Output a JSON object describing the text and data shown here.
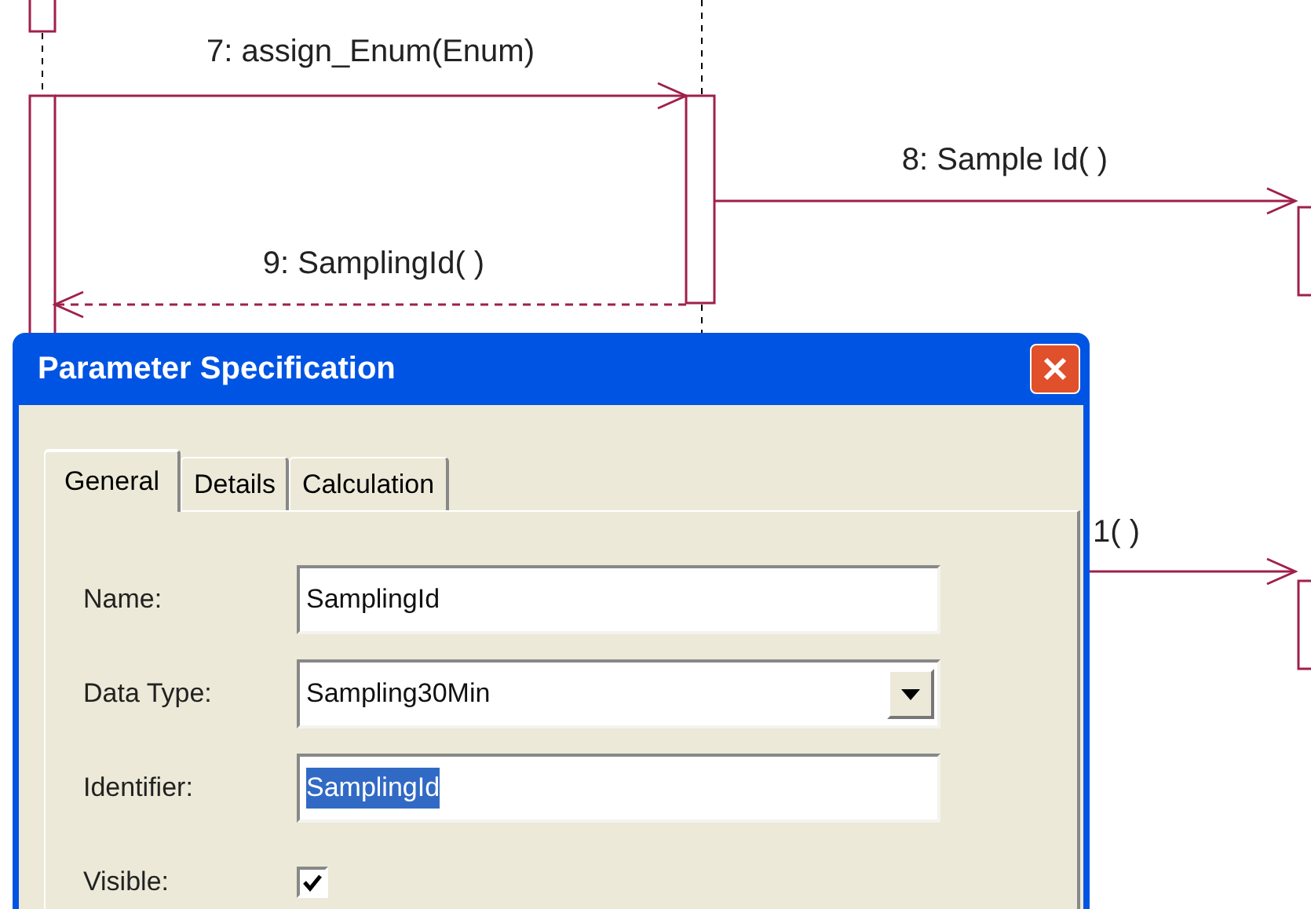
{
  "diagram": {
    "messages": [
      {
        "label": "7: assign_Enum(Enum)",
        "kind": "call"
      },
      {
        "label": "8: Sample Id( )",
        "kind": "call"
      },
      {
        "label": "9: SamplingId( )",
        "kind": "return"
      },
      {
        "label": "1( )",
        "kind": "call"
      }
    ]
  },
  "dialog": {
    "title": "Parameter Specification",
    "tabs": [
      {
        "label": "General",
        "selected": true
      },
      {
        "label": "Details",
        "selected": false
      },
      {
        "label": "Calculation",
        "selected": false
      }
    ],
    "fields": [
      {
        "label": "Name:",
        "kind": "text",
        "value": "SamplingId",
        "selected_text": false
      },
      {
        "label": "Data Type:",
        "kind": "dropdown",
        "value": "Sampling30Min",
        "selected_text": false
      },
      {
        "label": "Identifier:",
        "kind": "text",
        "value": "SamplingId",
        "selected_text": true
      },
      {
        "label": "Visible:",
        "kind": "checkbox",
        "checked": true
      }
    ]
  }
}
